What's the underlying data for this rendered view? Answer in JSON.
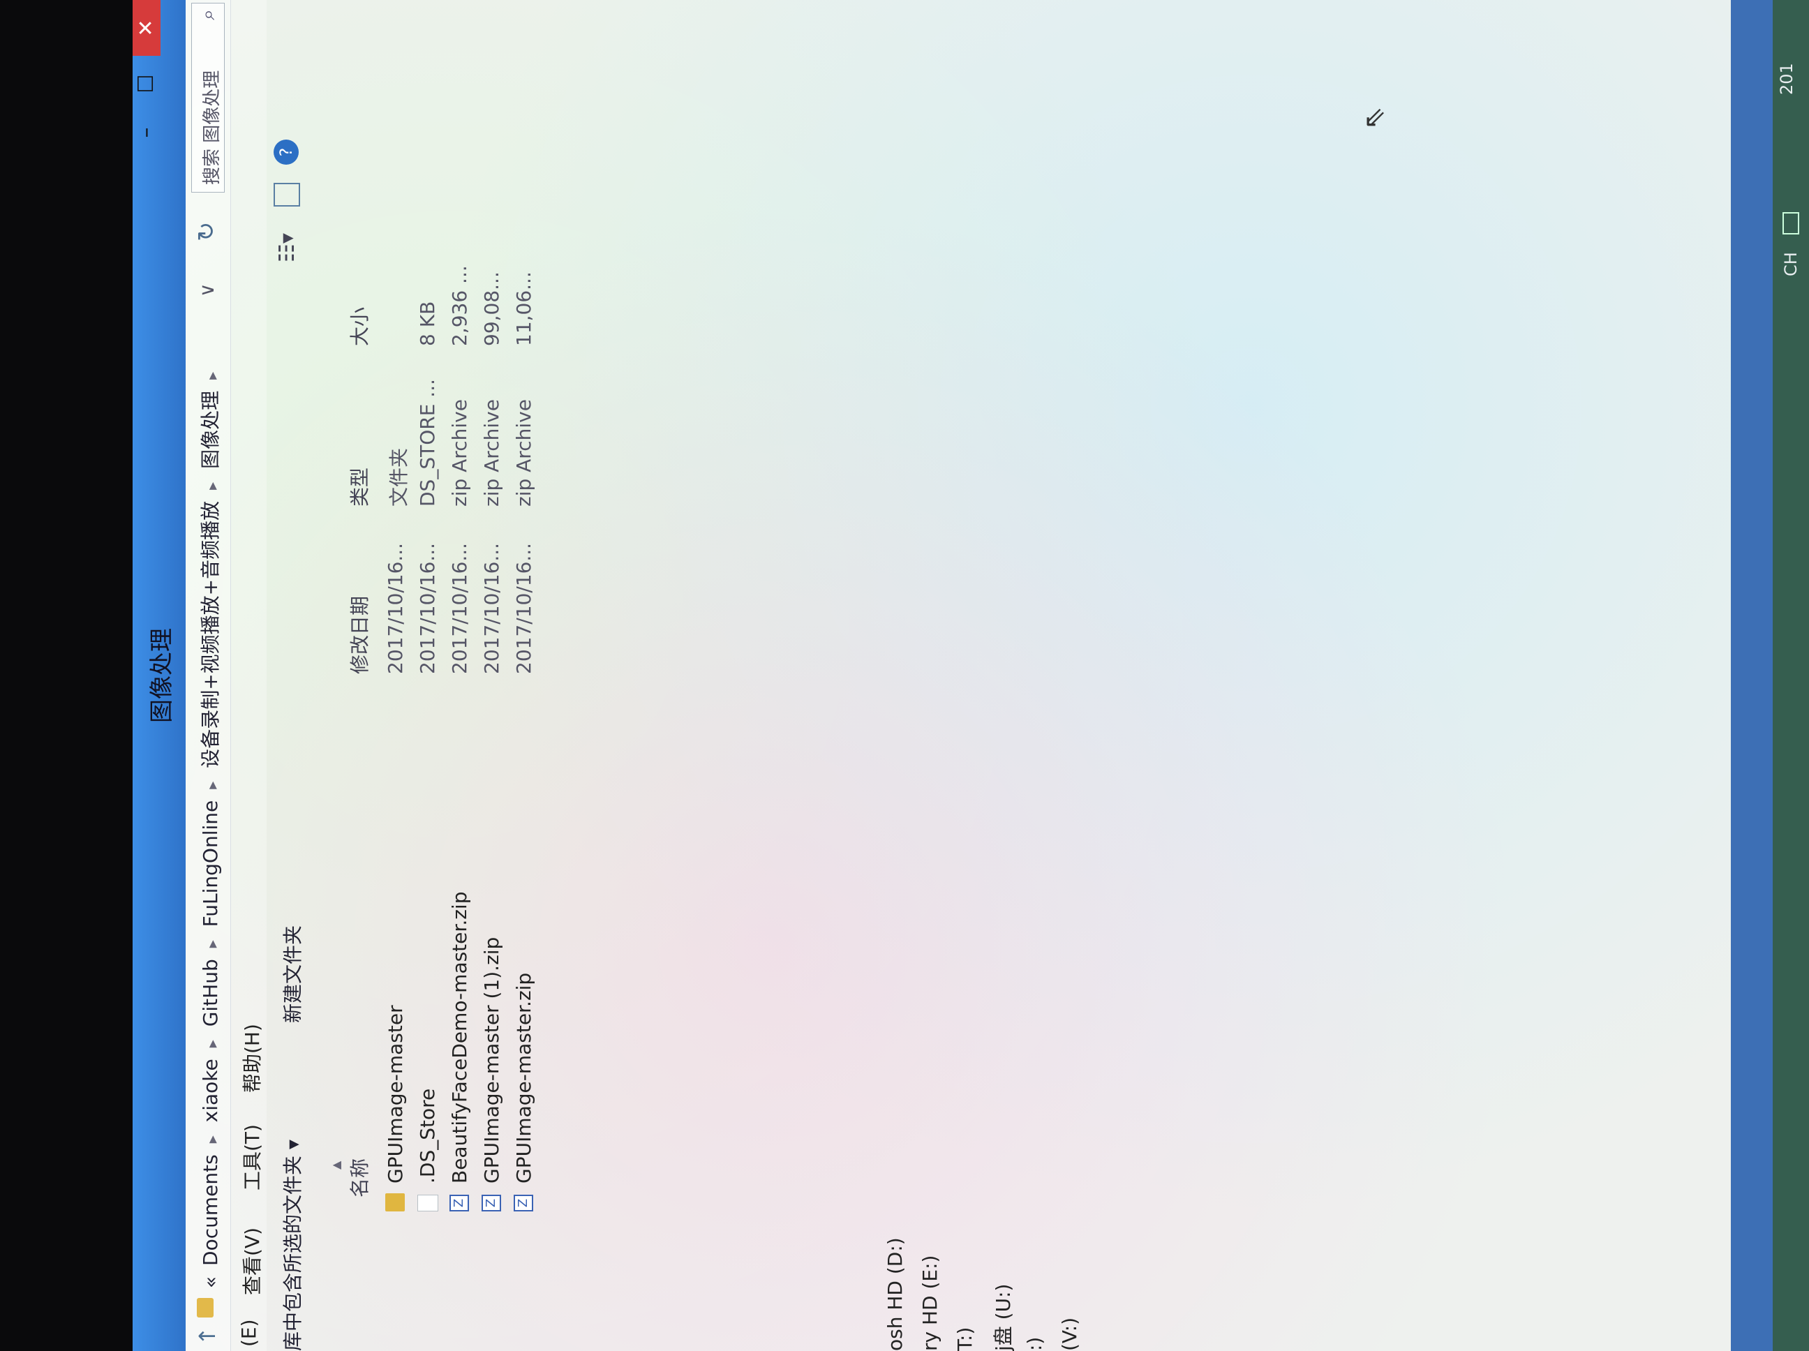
{
  "window": {
    "title": "图像处理",
    "min": "–",
    "max": "☐",
    "close": "✕"
  },
  "address": {
    "crumbs": [
      "Documents",
      "xiaoke",
      "GitHub",
      "FuLingOnline",
      "设备录制+视频播放+音频播放",
      "图像处理"
    ],
    "prefix": "«",
    "search_placeholder": "搜索 图像处理"
  },
  "menu": [
    "(E)",
    "查看(V)",
    "工具(T)",
    "帮助(H)"
  ],
  "toolbar": {
    "include": "库中包含所选的文件夹 ▾",
    "new_folder": "新建文件夹"
  },
  "sidebar": {
    "drives": [
      "osh HD (D:)",
      "ry HD (E:)",
      "T:)",
      "j盘 (U:)",
      ":)",
      "(V:)"
    ]
  },
  "columns": {
    "name": "名称",
    "date": "修改日期",
    "type": "类型",
    "size": "大小"
  },
  "files": [
    {
      "name": "GPUImage-master",
      "date": "2017/10/16...",
      "type": "文件夹",
      "size": "",
      "icon": "folder-icon"
    },
    {
      "name": ".DS_Store",
      "date": "2017/10/16...",
      "type": "DS_STORE ...",
      "size": "8 KB",
      "icon": "file-icon"
    },
    {
      "name": "BeautifyFaceDemo-master.zip",
      "date": "2017/10/16...",
      "type": "zip Archive",
      "size": "2,936 ...",
      "icon": "zip-icon"
    },
    {
      "name": "GPUImage-master (1).zip",
      "date": "2017/10/16...",
      "type": "zip Archive",
      "size": "99,08...",
      "icon": "zip-icon"
    },
    {
      "name": "GPUImage-master.zip",
      "date": "2017/10/16...",
      "type": "zip Archive",
      "size": "11,06...",
      "icon": "zip-icon"
    }
  ],
  "taskbar": {
    "lang": "CH",
    "clock": "201"
  }
}
